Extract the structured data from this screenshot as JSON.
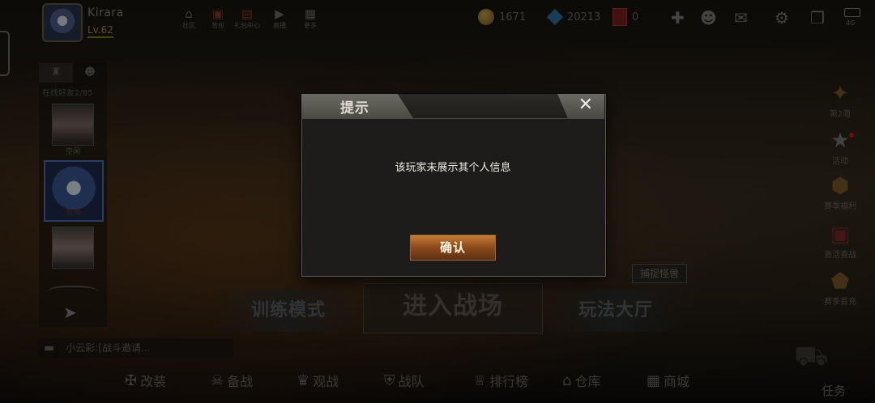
{
  "player": {
    "name": "Kirara",
    "level": "Lv.62"
  },
  "top_menu": [
    {
      "label": "社区",
      "icon": "home-icon"
    },
    {
      "label": "背包",
      "icon": "gift-box-icon"
    },
    {
      "label": "礼包中心",
      "icon": "gift-icon"
    },
    {
      "label": "直播",
      "icon": "play-icon"
    },
    {
      "label": "更多",
      "icon": "grid-icon"
    }
  ],
  "currencies": {
    "gold": "1671",
    "diamond": "20213",
    "card": "0"
  },
  "top_right_icons": [
    "plus-icon",
    "friends-icon",
    "mail-icon",
    "settings-icon",
    "book-icon"
  ],
  "status": {
    "network": "4G"
  },
  "friends": {
    "tabs": [
      "rank-icon",
      "friends-icon"
    ],
    "online_label": "在线好友2/85",
    "items": [
      {
        "name": "空闲"
      },
      {
        "name": "在线"
      },
      {
        "name": ""
      }
    ]
  },
  "side_buttons": [
    {
      "label": "第2周",
      "icon": "medal-icon"
    },
    {
      "label": "活动",
      "icon": "star-icon"
    },
    {
      "label": "赛季福利",
      "icon": "badge-icon"
    },
    {
      "label": "激活查战",
      "icon": "present-icon"
    },
    {
      "label": "赛季首充",
      "icon": "shield-icon"
    }
  ],
  "capture_label": "捕捉怪兽",
  "modes": {
    "training": "训练模式",
    "battle": "进入战场",
    "hall": "玩法大厅"
  },
  "chat": {
    "text": "小云彩:[战斗邀请..."
  },
  "bottom_nav": [
    {
      "label": "改装",
      "icon": "wrench-icon"
    },
    {
      "label": "备战",
      "icon": "skull-icon"
    },
    {
      "label": "观战",
      "icon": "crown-icon"
    },
    {
      "label": "战队",
      "icon": "team-icon"
    },
    {
      "label": "排行榜",
      "icon": "trophy-icon"
    },
    {
      "label": "仓库",
      "icon": "warehouse-icon"
    },
    {
      "label": "商城",
      "icon": "shop-icon"
    }
  ],
  "task_label": "任务",
  "dialog": {
    "title": "提示",
    "message": "该玩家未展示其个人信息",
    "confirm_label": "确认",
    "close_symbol": "✕"
  }
}
